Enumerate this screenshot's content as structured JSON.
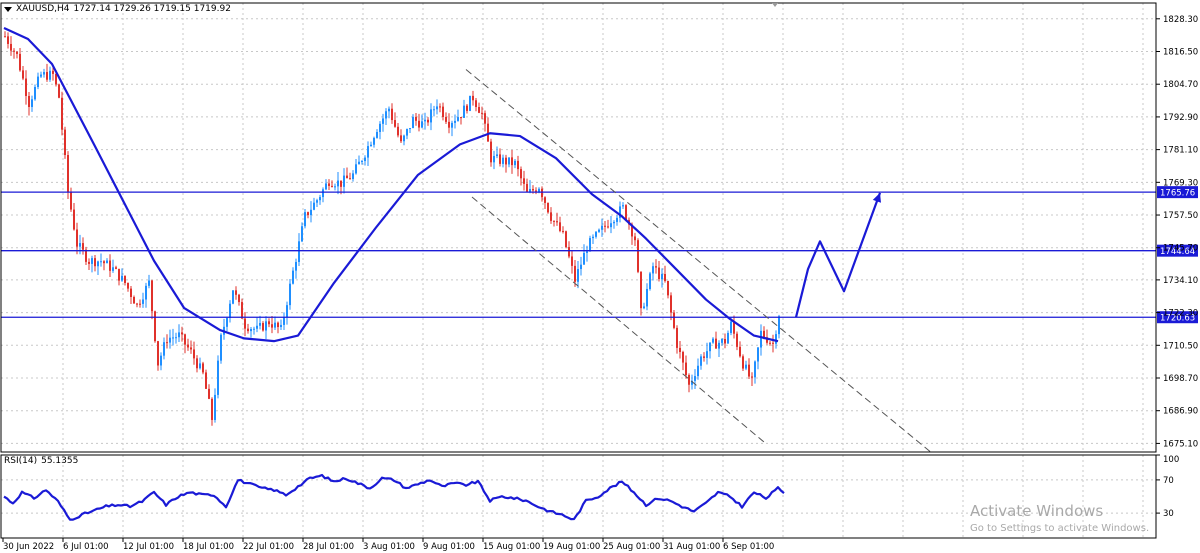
{
  "header": {
    "symbol": "XAUUSD,H4",
    "ohlc": "1727.14 1729.26 1719.15 1719.92"
  },
  "rsi_header": {
    "label": "RSI(14)",
    "value": "55.1355"
  },
  "watermark": {
    "title": "Activate Windows",
    "subtitle": "Go to Settings to activate Windows."
  },
  "colors": {
    "bull": "#1f8fff",
    "bear": "#e0312b",
    "ma": "#1a1ad6",
    "level": "#1a1ad6",
    "grid": "#c8c8c8",
    "channel": "#555555"
  },
  "chart_data": [
    {
      "type": "candlestick",
      "symbol": "XAUUSD",
      "timeframe": "H4",
      "y_axis_ticks": [
        1828.3,
        1816.5,
        1804.7,
        1792.9,
        1781.1,
        1769.3,
        1757.5,
        1745.7,
        1734.1,
        1722.3,
        1710.5,
        1698.7,
        1686.9,
        1675.1
      ],
      "ylim": [
        1672.0,
        1834.0
      ],
      "x_axis_ticks": [
        "30 Jun 2022",
        "6 Jul 01:00",
        "12 Jul 01:00",
        "18 Jul 01:00",
        "22 Jul 01:00",
        "28 Jul 01:00",
        "3 Aug 01:00",
        "9 Aug 01:00",
        "15 Aug 01:00",
        "19 Aug 01:00",
        "25 Aug 01:00",
        "31 Aug 01:00",
        "6 Sep 01:00"
      ],
      "candle_anchors": [
        {
          "i": 0,
          "p": 1822
        },
        {
          "i": 4,
          "p": 1815
        },
        {
          "i": 8,
          "p": 1798
        },
        {
          "i": 12,
          "p": 1808
        },
        {
          "i": 16,
          "p": 1808
        },
        {
          "i": 18,
          "p": 1800
        },
        {
          "i": 21,
          "p": 1766
        },
        {
          "i": 24,
          "p": 1747
        },
        {
          "i": 28,
          "p": 1741
        },
        {
          "i": 32,
          "p": 1741
        },
        {
          "i": 36,
          "p": 1738
        },
        {
          "i": 40,
          "p": 1733
        },
        {
          "i": 44,
          "p": 1725
        },
        {
          "i": 48,
          "p": 1733
        },
        {
          "i": 51,
          "p": 1704
        },
        {
          "i": 54,
          "p": 1713
        },
        {
          "i": 58,
          "p": 1714
        },
        {
          "i": 62,
          "p": 1708
        },
        {
          "i": 66,
          "p": 1700
        },
        {
          "i": 69,
          "p": 1684
        },
        {
          "i": 72,
          "p": 1713
        },
        {
          "i": 76,
          "p": 1731
        },
        {
          "i": 80,
          "p": 1718
        },
        {
          "i": 84,
          "p": 1716
        },
        {
          "i": 88,
          "p": 1719
        },
        {
          "i": 92,
          "p": 1716
        },
        {
          "i": 96,
          "p": 1737
        },
        {
          "i": 100,
          "p": 1757
        },
        {
          "i": 104,
          "p": 1763
        },
        {
          "i": 108,
          "p": 1770
        },
        {
          "i": 112,
          "p": 1769
        },
        {
          "i": 116,
          "p": 1772
        },
        {
          "i": 120,
          "p": 1780
        },
        {
          "i": 124,
          "p": 1789
        },
        {
          "i": 128,
          "p": 1796
        },
        {
          "i": 132,
          "p": 1783
        },
        {
          "i": 136,
          "p": 1792
        },
        {
          "i": 140,
          "p": 1790
        },
        {
          "i": 144,
          "p": 1798
        },
        {
          "i": 148,
          "p": 1791
        },
        {
          "i": 152,
          "p": 1794
        },
        {
          "i": 156,
          "p": 1800
        },
        {
          "i": 159,
          "p": 1794
        },
        {
          "i": 162,
          "p": 1778
        },
        {
          "i": 166,
          "p": 1777
        },
        {
          "i": 170,
          "p": 1776
        },
        {
          "i": 174,
          "p": 1765
        },
        {
          "i": 178,
          "p": 1768
        },
        {
          "i": 182,
          "p": 1757
        },
        {
          "i": 186,
          "p": 1750
        },
        {
          "i": 190,
          "p": 1734
        },
        {
          "i": 194,
          "p": 1746
        },
        {
          "i": 198,
          "p": 1751
        },
        {
          "i": 202,
          "p": 1756
        },
        {
          "i": 206,
          "p": 1760
        },
        {
          "i": 210,
          "p": 1749
        },
        {
          "i": 212,
          "p": 1722
        },
        {
          "i": 216,
          "p": 1739
        },
        {
          "i": 220,
          "p": 1733
        },
        {
          "i": 224,
          "p": 1711
        },
        {
          "i": 228,
          "p": 1696
        },
        {
          "i": 232,
          "p": 1706
        },
        {
          "i": 236,
          "p": 1711
        },
        {
          "i": 240,
          "p": 1712
        },
        {
          "i": 242,
          "p": 1718
        },
        {
          "i": 246,
          "p": 1704
        },
        {
          "i": 249,
          "p": 1697
        },
        {
          "i": 252,
          "p": 1715
        },
        {
          "i": 256,
          "p": 1711
        },
        {
          "i": 258,
          "p": 1722
        }
      ],
      "moving_average": [
        {
          "i": 0,
          "p": 1825
        },
        {
          "i": 8,
          "p": 1821
        },
        {
          "i": 16,
          "p": 1812
        },
        {
          "i": 30,
          "p": 1783
        },
        {
          "i": 50,
          "p": 1741
        },
        {
          "i": 60,
          "p": 1724
        },
        {
          "i": 72,
          "p": 1716
        },
        {
          "i": 80,
          "p": 1713
        },
        {
          "i": 90,
          "p": 1712
        },
        {
          "i": 98,
          "p": 1714
        },
        {
          "i": 110,
          "p": 1733
        },
        {
          "i": 124,
          "p": 1753
        },
        {
          "i": 138,
          "p": 1772
        },
        {
          "i": 152,
          "p": 1783
        },
        {
          "i": 162,
          "p": 1787
        },
        {
          "i": 172,
          "p": 1786
        },
        {
          "i": 184,
          "p": 1778
        },
        {
          "i": 196,
          "p": 1765
        },
        {
          "i": 206,
          "p": 1757
        },
        {
          "i": 214,
          "p": 1749
        },
        {
          "i": 224,
          "p": 1738
        },
        {
          "i": 234,
          "p": 1727
        },
        {
          "i": 242,
          "p": 1720
        },
        {
          "i": 250,
          "p": 1714
        },
        {
          "i": 258,
          "p": 1712
        }
      ],
      "horizontal_levels": [
        {
          "price": 1765.76,
          "label": "1765.76"
        },
        {
          "price": 1744.64,
          "label": "1744.64"
        },
        {
          "price": 1720.63,
          "label": "1720.63"
        }
      ],
      "channel_lines": [
        {
          "from": {
            "i": 154,
            "p": 1810
          },
          "to": {
            "i": 310,
            "p": 1671
          }
        },
        {
          "from": {
            "i": 156,
            "p": 1764
          },
          "to": {
            "i": 254,
            "p": 1675
          }
        }
      ],
      "projection_path": [
        {
          "i": 264,
          "p": 1720.6
        },
        {
          "i": 268,
          "p": 1738
        },
        {
          "i": 272,
          "p": 1748
        },
        {
          "i": 280,
          "p": 1730
        },
        {
          "i": 292,
          "p": 1765.5
        }
      ]
    },
    {
      "type": "line",
      "name": "RSI(14)",
      "y_axis_ticks": [
        100,
        70,
        30
      ],
      "ylim": [
        0,
        100
      ],
      "values_anchors": [
        {
          "i": 0,
          "v": 50
        },
        {
          "i": 3,
          "v": 42
        },
        {
          "i": 6,
          "v": 55
        },
        {
          "i": 10,
          "v": 48
        },
        {
          "i": 14,
          "v": 58
        },
        {
          "i": 18,
          "v": 44
        },
        {
          "i": 22,
          "v": 22
        },
        {
          "i": 26,
          "v": 28
        },
        {
          "i": 30,
          "v": 33
        },
        {
          "i": 34,
          "v": 38
        },
        {
          "i": 38,
          "v": 40
        },
        {
          "i": 42,
          "v": 38
        },
        {
          "i": 46,
          "v": 44
        },
        {
          "i": 50,
          "v": 55
        },
        {
          "i": 54,
          "v": 40
        },
        {
          "i": 58,
          "v": 50
        },
        {
          "i": 62,
          "v": 55
        },
        {
          "i": 66,
          "v": 52
        },
        {
          "i": 70,
          "v": 52
        },
        {
          "i": 74,
          "v": 38
        },
        {
          "i": 78,
          "v": 70
        },
        {
          "i": 82,
          "v": 65
        },
        {
          "i": 86,
          "v": 60
        },
        {
          "i": 90,
          "v": 58
        },
        {
          "i": 94,
          "v": 52
        },
        {
          "i": 98,
          "v": 62
        },
        {
          "i": 102,
          "v": 72
        },
        {
          "i": 106,
          "v": 75
        },
        {
          "i": 110,
          "v": 68
        },
        {
          "i": 114,
          "v": 72
        },
        {
          "i": 118,
          "v": 66
        },
        {
          "i": 122,
          "v": 60
        },
        {
          "i": 126,
          "v": 72
        },
        {
          "i": 130,
          "v": 70
        },
        {
          "i": 134,
          "v": 60
        },
        {
          "i": 138,
          "v": 65
        },
        {
          "i": 142,
          "v": 70
        },
        {
          "i": 146,
          "v": 62
        },
        {
          "i": 150,
          "v": 66
        },
        {
          "i": 154,
          "v": 64
        },
        {
          "i": 158,
          "v": 68
        },
        {
          "i": 162,
          "v": 45
        },
        {
          "i": 166,
          "v": 50
        },
        {
          "i": 170,
          "v": 48
        },
        {
          "i": 174,
          "v": 45
        },
        {
          "i": 178,
          "v": 38
        },
        {
          "i": 182,
          "v": 32
        },
        {
          "i": 186,
          "v": 28
        },
        {
          "i": 190,
          "v": 22
        },
        {
          "i": 194,
          "v": 45
        },
        {
          "i": 198,
          "v": 50
        },
        {
          "i": 202,
          "v": 60
        },
        {
          "i": 206,
          "v": 68
        },
        {
          "i": 210,
          "v": 55
        },
        {
          "i": 214,
          "v": 40
        },
        {
          "i": 218,
          "v": 48
        },
        {
          "i": 222,
          "v": 45
        },
        {
          "i": 226,
          "v": 38
        },
        {
          "i": 230,
          "v": 32
        },
        {
          "i": 234,
          "v": 42
        },
        {
          "i": 238,
          "v": 55
        },
        {
          "i": 242,
          "v": 50
        },
        {
          "i": 246,
          "v": 38
        },
        {
          "i": 250,
          "v": 55
        },
        {
          "i": 254,
          "v": 48
        },
        {
          "i": 258,
          "v": 60
        },
        {
          "i": 260,
          "v": 55
        }
      ]
    }
  ]
}
